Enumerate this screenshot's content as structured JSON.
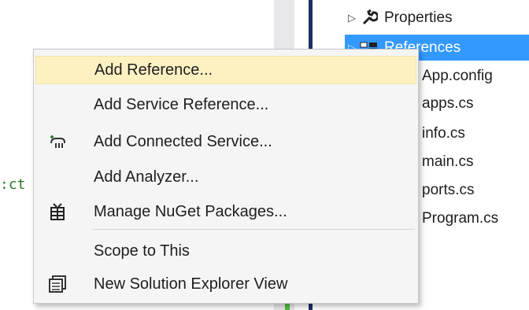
{
  "editor": {
    "code_fragment": ":ct"
  },
  "explorer": {
    "items": [
      {
        "label": "Properties",
        "icon": "wrench-icon",
        "expandable": true,
        "selected": false
      },
      {
        "label": "References",
        "icon": "references-icon",
        "expandable": true,
        "selected": true
      },
      {
        "label": "App.config",
        "icon": "config-file-icon",
        "expandable": false,
        "selected": false
      },
      {
        "label": "apps.cs",
        "icon": "cs-file-icon",
        "expandable": false,
        "selected": false
      },
      {
        "label": "info.cs",
        "icon": "cs-file-icon",
        "expandable": false,
        "selected": false
      },
      {
        "label": "main.cs",
        "icon": "cs-file-icon",
        "expandable": false,
        "selected": false
      },
      {
        "label": "ports.cs",
        "icon": "cs-file-icon",
        "expandable": false,
        "selected": false
      },
      {
        "label": "Program.cs",
        "icon": "cs-file-icon",
        "expandable": false,
        "selected": false
      }
    ]
  },
  "context_menu": {
    "items": [
      {
        "label": "Add Reference...",
        "icon": "",
        "highlighted": true
      },
      {
        "label": "Add Service Reference...",
        "icon": ""
      },
      {
        "label": "Add Connected Service...",
        "icon": "connected-service-icon"
      },
      {
        "label": "Add Analyzer...",
        "icon": ""
      },
      {
        "label": "Manage NuGet Packages...",
        "icon": "nuget-package-icon"
      },
      {
        "label": "Scope to This",
        "icon": ""
      },
      {
        "label": "New Solution Explorer View",
        "icon": "new-explorer-view-icon"
      }
    ]
  },
  "colors": {
    "selection": "#3399ff",
    "menu_highlight": "#fdf1c2",
    "menu_background": "#f5f5f5",
    "scrollbar_marker": "#4cbb3c"
  }
}
